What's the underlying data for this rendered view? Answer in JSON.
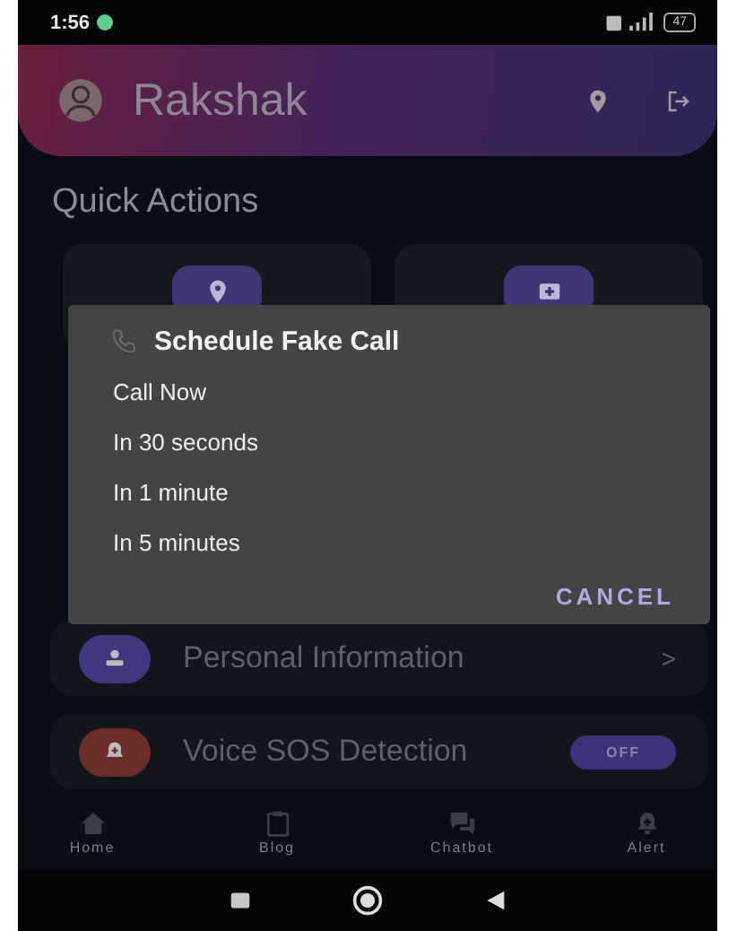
{
  "status_bar": {
    "time": "1:56",
    "battery": "47"
  },
  "header": {
    "title": "Rakshak"
  },
  "quick_actions": {
    "title": "Quick Actions",
    "cards": [
      {
        "kind": "location"
      },
      {
        "kind": "medical"
      }
    ]
  },
  "dialog": {
    "title": "Schedule Fake Call",
    "options": [
      "Call Now",
      "In 30 seconds",
      "In 1 minute",
      "In 5 minutes"
    ],
    "cancel": "CANCEL"
  },
  "settings": [
    {
      "kind": "link",
      "label": "Personal Information",
      "chevron": ">"
    },
    {
      "kind": "toggle",
      "label": "Voice SOS Detection",
      "on": false,
      "toggle_label": "OFF"
    }
  ],
  "bottom_nav": [
    {
      "kind": "home",
      "label": "Home"
    },
    {
      "kind": "blog",
      "label": "Blog"
    },
    {
      "kind": "chat",
      "label": "Chatbot"
    },
    {
      "kind": "alert",
      "label": "Alert"
    }
  ]
}
